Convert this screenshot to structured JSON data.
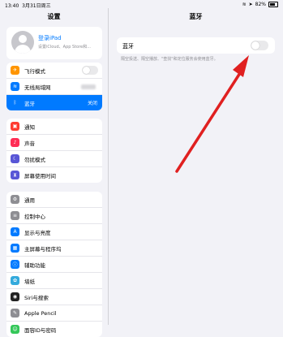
{
  "status": {
    "time": "13:40",
    "date": "3月31日周三",
    "battery": "82%"
  },
  "sidebar": {
    "title": "设置",
    "profile": {
      "title": "登录iPad",
      "subtitle": "设置iCloud、App Store和..."
    },
    "group1": [
      {
        "label": "飞行模式",
        "icon": "airplane-icon",
        "color": "#ff9500",
        "glyph": "✈"
      },
      {
        "label": "无线局域网",
        "icon": "wifi-icon",
        "color": "#007aff",
        "glyph": "≋"
      },
      {
        "label": "蓝牙",
        "icon": "bluetooth-icon",
        "color": "#007aff",
        "glyph": "ᛒ",
        "value": "关闭"
      }
    ],
    "group2": [
      {
        "label": "通知",
        "icon": "notifications-icon",
        "color": "#ff3b30",
        "glyph": "▣"
      },
      {
        "label": "声音",
        "icon": "sound-icon",
        "color": "#ff2d55",
        "glyph": "♪"
      },
      {
        "label": "勿扰模式",
        "icon": "moon-icon",
        "color": "#5856d6",
        "glyph": "☾"
      },
      {
        "label": "屏幕使用时间",
        "icon": "hourglass-icon",
        "color": "#5856d6",
        "glyph": "⧗"
      }
    ],
    "group3": [
      {
        "label": "通用",
        "icon": "gear-icon",
        "color": "#8e8e93",
        "glyph": "⚙"
      },
      {
        "label": "控制中心",
        "icon": "control-center-icon",
        "color": "#8e8e93",
        "glyph": "≡"
      },
      {
        "label": "显示与亮度",
        "icon": "display-icon",
        "color": "#007aff",
        "glyph": "A"
      },
      {
        "label": "主屏幕与程序坞",
        "icon": "home-screen-icon",
        "color": "#007aff",
        "glyph": "▦"
      },
      {
        "label": "辅助功能",
        "icon": "accessibility-icon",
        "color": "#007aff",
        "glyph": "ⓘ"
      },
      {
        "label": "墙纸",
        "icon": "wallpaper-icon",
        "color": "#34aadc",
        "glyph": "✿"
      },
      {
        "label": "Siri与搜索",
        "icon": "siri-icon",
        "color": "#222222",
        "glyph": "◉"
      },
      {
        "label": "Apple Pencil",
        "icon": "pencil-icon",
        "color": "#8e8e93",
        "glyph": "✎"
      },
      {
        "label": "面容ID与密码",
        "icon": "face-id-icon",
        "color": "#34c759",
        "glyph": "☺"
      }
    ]
  },
  "main": {
    "title": "蓝牙",
    "bluetooth_label": "蓝牙",
    "description": "隔空投送、隔空播放、\"查找\"和定位服务会使用蓝牙。"
  },
  "annotation": {
    "color": "#e02020"
  }
}
